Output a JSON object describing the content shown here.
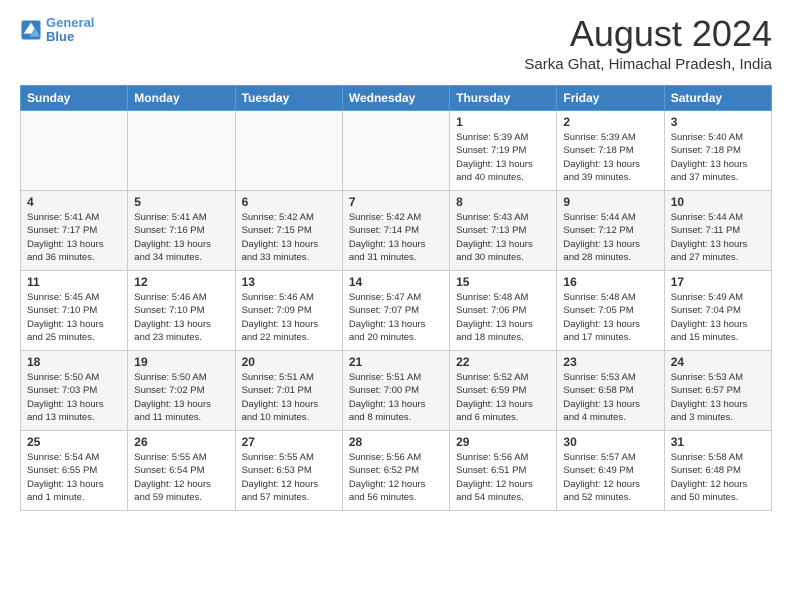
{
  "header": {
    "logo_line1": "General",
    "logo_line2": "Blue",
    "month_year": "August 2024",
    "location": "Sarka Ghat, Himachal Pradesh, India"
  },
  "days_of_week": [
    "Sunday",
    "Monday",
    "Tuesday",
    "Wednesday",
    "Thursday",
    "Friday",
    "Saturday"
  ],
  "weeks": [
    [
      {
        "day": "",
        "empty": true
      },
      {
        "day": "",
        "empty": true
      },
      {
        "day": "",
        "empty": true
      },
      {
        "day": "",
        "empty": true
      },
      {
        "day": "1",
        "sunrise": "Sunrise: 5:39 AM",
        "sunset": "Sunset: 7:19 PM",
        "daylight": "Daylight: 13 hours and 40 minutes."
      },
      {
        "day": "2",
        "sunrise": "Sunrise: 5:39 AM",
        "sunset": "Sunset: 7:18 PM",
        "daylight": "Daylight: 13 hours and 39 minutes."
      },
      {
        "day": "3",
        "sunrise": "Sunrise: 5:40 AM",
        "sunset": "Sunset: 7:18 PM",
        "daylight": "Daylight: 13 hours and 37 minutes."
      }
    ],
    [
      {
        "day": "4",
        "sunrise": "Sunrise: 5:41 AM",
        "sunset": "Sunset: 7:17 PM",
        "daylight": "Daylight: 13 hours and 36 minutes."
      },
      {
        "day": "5",
        "sunrise": "Sunrise: 5:41 AM",
        "sunset": "Sunset: 7:16 PM",
        "daylight": "Daylight: 13 hours and 34 minutes."
      },
      {
        "day": "6",
        "sunrise": "Sunrise: 5:42 AM",
        "sunset": "Sunset: 7:15 PM",
        "daylight": "Daylight: 13 hours and 33 minutes."
      },
      {
        "day": "7",
        "sunrise": "Sunrise: 5:42 AM",
        "sunset": "Sunset: 7:14 PM",
        "daylight": "Daylight: 13 hours and 31 minutes."
      },
      {
        "day": "8",
        "sunrise": "Sunrise: 5:43 AM",
        "sunset": "Sunset: 7:13 PM",
        "daylight": "Daylight: 13 hours and 30 minutes."
      },
      {
        "day": "9",
        "sunrise": "Sunrise: 5:44 AM",
        "sunset": "Sunset: 7:12 PM",
        "daylight": "Daylight: 13 hours and 28 minutes."
      },
      {
        "day": "10",
        "sunrise": "Sunrise: 5:44 AM",
        "sunset": "Sunset: 7:11 PM",
        "daylight": "Daylight: 13 hours and 27 minutes."
      }
    ],
    [
      {
        "day": "11",
        "sunrise": "Sunrise: 5:45 AM",
        "sunset": "Sunset: 7:10 PM",
        "daylight": "Daylight: 13 hours and 25 minutes."
      },
      {
        "day": "12",
        "sunrise": "Sunrise: 5:46 AM",
        "sunset": "Sunset: 7:10 PM",
        "daylight": "Daylight: 13 hours and 23 minutes."
      },
      {
        "day": "13",
        "sunrise": "Sunrise: 5:46 AM",
        "sunset": "Sunset: 7:09 PM",
        "daylight": "Daylight: 13 hours and 22 minutes."
      },
      {
        "day": "14",
        "sunrise": "Sunrise: 5:47 AM",
        "sunset": "Sunset: 7:07 PM",
        "daylight": "Daylight: 13 hours and 20 minutes."
      },
      {
        "day": "15",
        "sunrise": "Sunrise: 5:48 AM",
        "sunset": "Sunset: 7:06 PM",
        "daylight": "Daylight: 13 hours and 18 minutes."
      },
      {
        "day": "16",
        "sunrise": "Sunrise: 5:48 AM",
        "sunset": "Sunset: 7:05 PM",
        "daylight": "Daylight: 13 hours and 17 minutes."
      },
      {
        "day": "17",
        "sunrise": "Sunrise: 5:49 AM",
        "sunset": "Sunset: 7:04 PM",
        "daylight": "Daylight: 13 hours and 15 minutes."
      }
    ],
    [
      {
        "day": "18",
        "sunrise": "Sunrise: 5:50 AM",
        "sunset": "Sunset: 7:03 PM",
        "daylight": "Daylight: 13 hours and 13 minutes."
      },
      {
        "day": "19",
        "sunrise": "Sunrise: 5:50 AM",
        "sunset": "Sunset: 7:02 PM",
        "daylight": "Daylight: 13 hours and 11 minutes."
      },
      {
        "day": "20",
        "sunrise": "Sunrise: 5:51 AM",
        "sunset": "Sunset: 7:01 PM",
        "daylight": "Daylight: 13 hours and 10 minutes."
      },
      {
        "day": "21",
        "sunrise": "Sunrise: 5:51 AM",
        "sunset": "Sunset: 7:00 PM",
        "daylight": "Daylight: 13 hours and 8 minutes."
      },
      {
        "day": "22",
        "sunrise": "Sunrise: 5:52 AM",
        "sunset": "Sunset: 6:59 PM",
        "daylight": "Daylight: 13 hours and 6 minutes."
      },
      {
        "day": "23",
        "sunrise": "Sunrise: 5:53 AM",
        "sunset": "Sunset: 6:58 PM",
        "daylight": "Daylight: 13 hours and 4 minutes."
      },
      {
        "day": "24",
        "sunrise": "Sunrise: 5:53 AM",
        "sunset": "Sunset: 6:57 PM",
        "daylight": "Daylight: 13 hours and 3 minutes."
      }
    ],
    [
      {
        "day": "25",
        "sunrise": "Sunrise: 5:54 AM",
        "sunset": "Sunset: 6:55 PM",
        "daylight": "Daylight: 13 hours and 1 minute."
      },
      {
        "day": "26",
        "sunrise": "Sunrise: 5:55 AM",
        "sunset": "Sunset: 6:54 PM",
        "daylight": "Daylight: 12 hours and 59 minutes."
      },
      {
        "day": "27",
        "sunrise": "Sunrise: 5:55 AM",
        "sunset": "Sunset: 6:53 PM",
        "daylight": "Daylight: 12 hours and 57 minutes."
      },
      {
        "day": "28",
        "sunrise": "Sunrise: 5:56 AM",
        "sunset": "Sunset: 6:52 PM",
        "daylight": "Daylight: 12 hours and 56 minutes."
      },
      {
        "day": "29",
        "sunrise": "Sunrise: 5:56 AM",
        "sunset": "Sunset: 6:51 PM",
        "daylight": "Daylight: 12 hours and 54 minutes."
      },
      {
        "day": "30",
        "sunrise": "Sunrise: 5:57 AM",
        "sunset": "Sunset: 6:49 PM",
        "daylight": "Daylight: 12 hours and 52 minutes."
      },
      {
        "day": "31",
        "sunrise": "Sunrise: 5:58 AM",
        "sunset": "Sunset: 6:48 PM",
        "daylight": "Daylight: 12 hours and 50 minutes."
      }
    ]
  ]
}
